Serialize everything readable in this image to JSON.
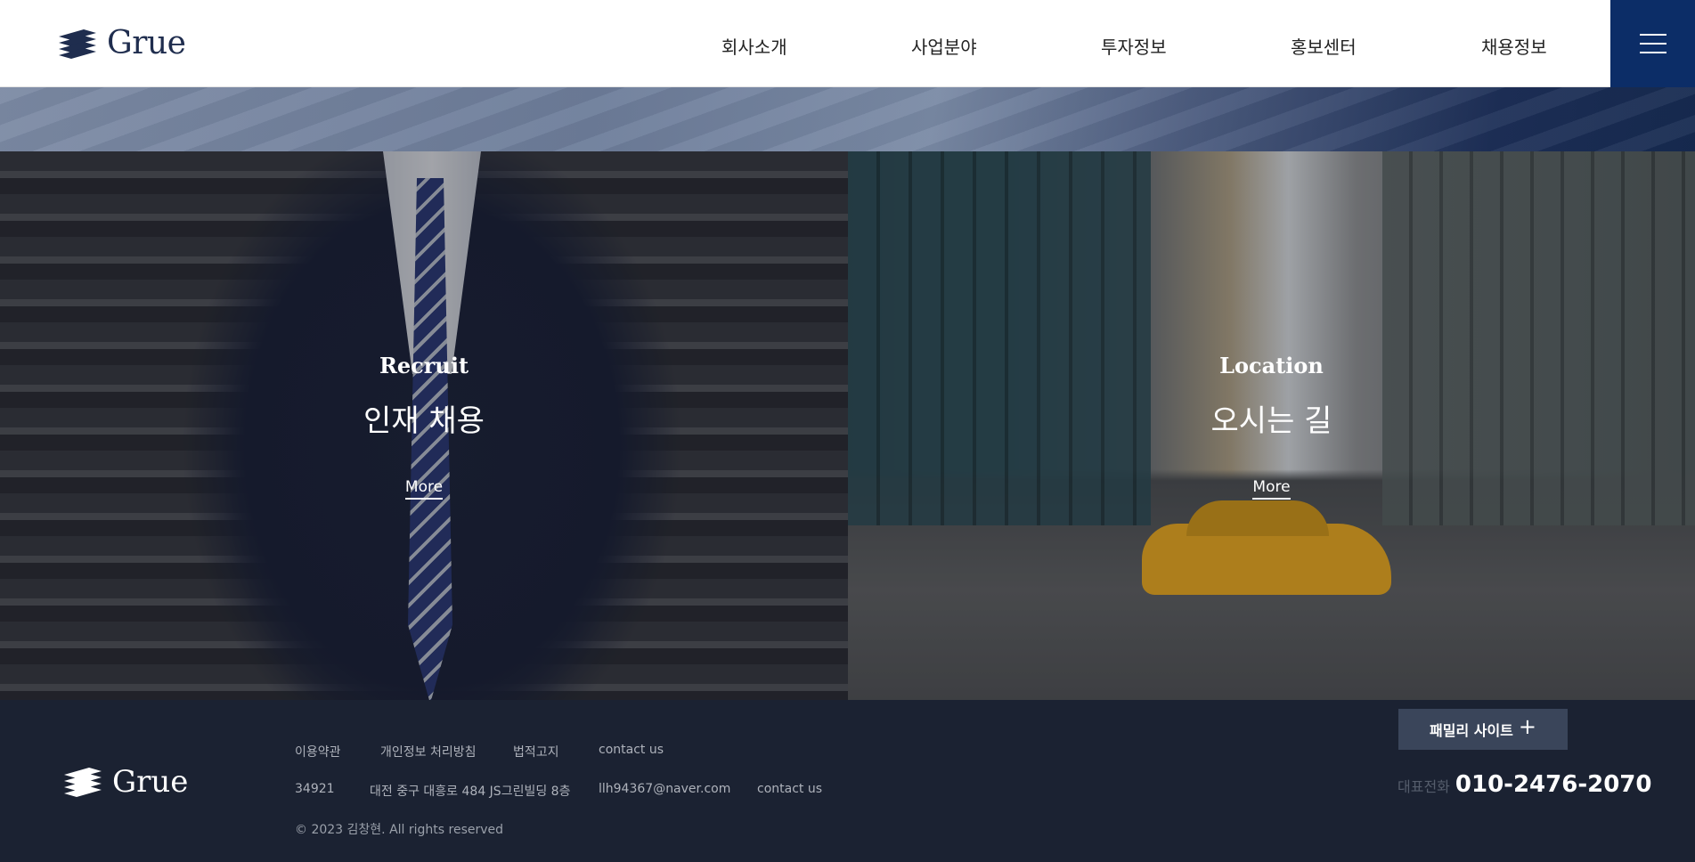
{
  "header": {
    "logo_text": "Grue",
    "nav": [
      "회사소개",
      "사업분야",
      "투자정보",
      "홍보센터",
      "채용정보"
    ]
  },
  "panels": {
    "recruit": {
      "title_en": "Recruit",
      "title_ko": "인재 채용",
      "more": "More"
    },
    "location": {
      "title_en": "Location",
      "title_ko": "오시는 길",
      "more": "More"
    }
  },
  "footer": {
    "logo_text": "Grue",
    "links": [
      "이용약관",
      "개인정보 처리방침",
      "법적고지",
      "contact us"
    ],
    "info": [
      "34921",
      "대전 중구 대흥로 484 JS그린빌딩 8층",
      "llh94367@naver.com",
      "contact us"
    ],
    "copyright": "© 2023 김창현. All rights reserved",
    "family_site": "패밀리 사이트",
    "family_plus": "+",
    "tel_label": "대표전화",
    "tel_number": "010-2476-2070"
  },
  "colors": {
    "brand_navy": "#0c2d67",
    "footer_bg": "#1b2232",
    "family_btn": "#3a455a"
  },
  "icons": [
    "logo-stripes-icon",
    "hamburger-icon",
    "plus-icon"
  ]
}
